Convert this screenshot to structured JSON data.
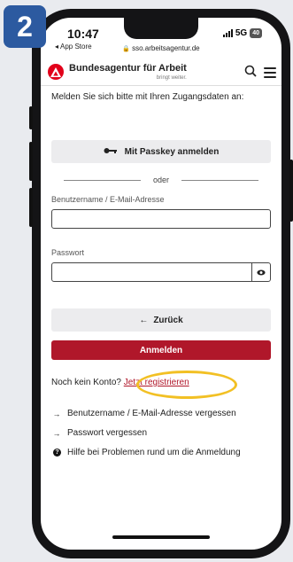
{
  "step_badge": "2",
  "status": {
    "time": "10:47",
    "back_app": "App Store",
    "network": "5G",
    "battery": "40",
    "url": "sso.arbeitsagentur.de"
  },
  "header": {
    "brand_name": "Bundesagentur für Arbeit",
    "tagline": "bringt weiter.",
    "logo_color": "#e2001a"
  },
  "login": {
    "intro": "Melden Sie sich bitte mit Ihren Zugangsdaten an:",
    "passkey_button": "Mit Passkey anmelden",
    "divider": "oder",
    "username_label": "Benutzername / E-Mail-Adresse",
    "username_value": "",
    "password_label": "Passwort",
    "password_value": "",
    "back_button": "Zurück",
    "login_button": "Anmelden",
    "login_color": "#b0172a"
  },
  "register": {
    "prompt": "Noch kein Konto?",
    "link": "Jetzt registrieren"
  },
  "links": [
    {
      "icon": "arrow-right-icon",
      "label": "Benutzername / E-Mail-Adresse vergessen"
    },
    {
      "icon": "arrow-right-icon",
      "label": "Passwort vergessen"
    },
    {
      "icon": "help-icon",
      "label": "Hilfe bei Problemen rund um die Anmeldung"
    }
  ],
  "highlight_color": "#f2c024"
}
